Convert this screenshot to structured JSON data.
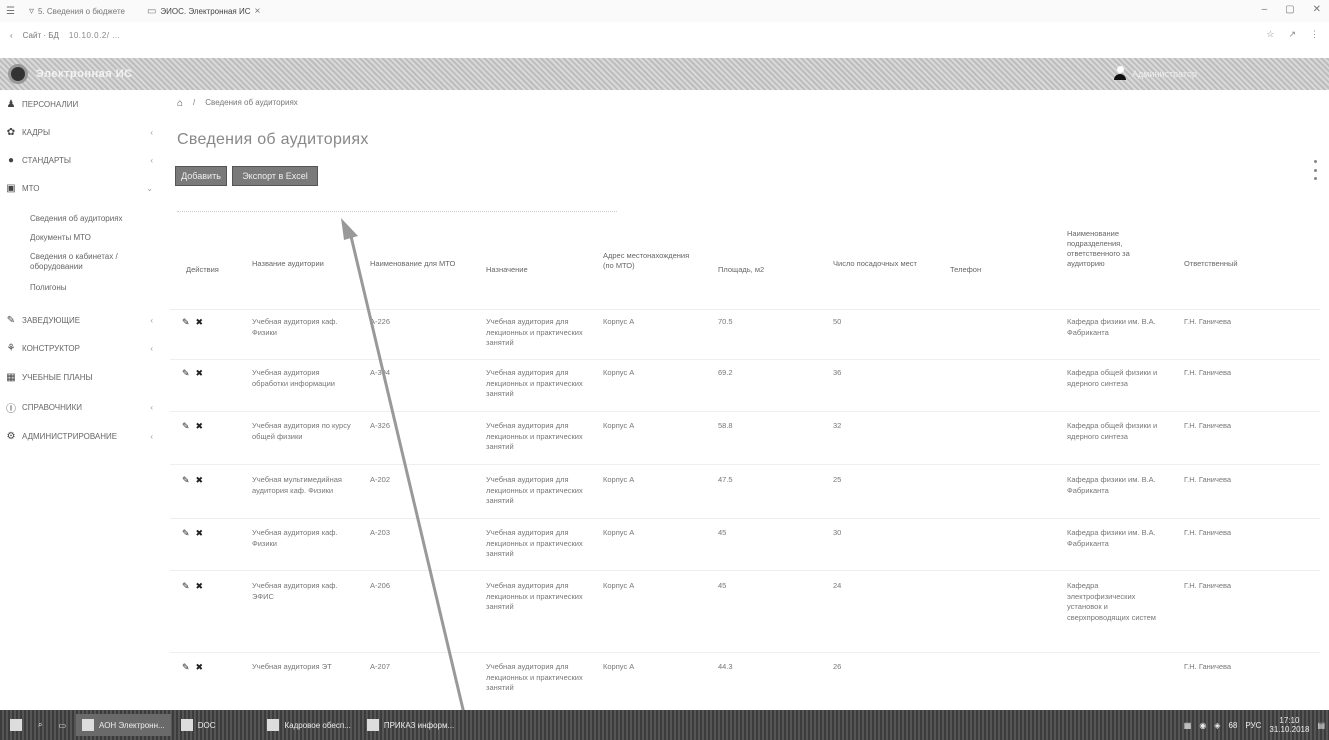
{
  "browser": {
    "tabs": [
      {
        "label": "5. Сведения о бюджете"
      },
      {
        "label": "ЭИОС. Электронная ИС"
      }
    ],
    "address_left": "Сайт  ·  БД",
    "address_url": "10.10.0.2/ ...",
    "window_controls": [
      "–",
      "▢",
      "✕"
    ],
    "addr_icons": [
      "☆",
      "↗",
      "⋮"
    ]
  },
  "header": {
    "app_title": "Электронная ИС",
    "user_name": "Администратор"
  },
  "sidebar": {
    "items": [
      {
        "label": "Персоналии",
        "icon": "user-icon",
        "glyph": "♟"
      },
      {
        "label": "Кадры",
        "icon": "award-icon",
        "glyph": "✿"
      },
      {
        "label": "Стандарты",
        "icon": "circle-icon",
        "glyph": "●"
      },
      {
        "label": "МТО",
        "icon": "chart-icon",
        "glyph": "▣"
      },
      {
        "label": "Заведующие",
        "icon": "book-icon",
        "glyph": "✎"
      },
      {
        "label": "Конструктор",
        "icon": "sitemap-icon",
        "glyph": "⚘"
      },
      {
        "label": "Учебные планы",
        "icon": "table-icon",
        "glyph": "▦"
      },
      {
        "label": "Справочники",
        "icon": "info-icon",
        "glyph": "ⓘ"
      },
      {
        "label": "Администрирование",
        "icon": "cogs-icon",
        "glyph": "⚙"
      }
    ],
    "subitems": [
      "Сведения об аудиториях",
      "Документы МТО",
      "Сведения о кабинетах / оборудовании",
      "Полигоны"
    ]
  },
  "main": {
    "breadcrumb_home": "⌂",
    "breadcrumb_sep": "/",
    "breadcrumb_current": "Сведения об аудиториях",
    "title": "Сведения об аудиториях",
    "btn_add": "Добавить",
    "btn_excel": "Экспорт в Excel"
  },
  "table": {
    "headers": [
      "Действия",
      "Название аудитории",
      "Наименование для МТО",
      "Назначение",
      "Адрес местонахождения (по МТО)",
      "Площадь, м2",
      "Число посадочных мест",
      "Телефон",
      "Наименование подразделения, ответственного за аудиторию",
      "Ответственный"
    ],
    "rows": [
      {
        "name": "Учебная аудитория каф. Физики",
        "mto": "A-226",
        "purpose": "Учебная аудитория для лекционных и практических занятий",
        "address": "Корпус А",
        "area": "70.5",
        "seats": "50",
        "phone": "",
        "dept": "Кафедра физики им. В.А. Фабриканта",
        "resp": "Г.Н. Ганичева"
      },
      {
        "name": "Учебная аудитория обработки информации",
        "mto": "A-304",
        "purpose": "Учебная аудитория для лекционных и практических занятий",
        "address": "Корпус А",
        "area": "69.2",
        "seats": "36",
        "phone": "",
        "dept": "Кафедра общей физики и ядерного синтеза",
        "resp": "Г.Н. Ганичева"
      },
      {
        "name": "Учебная аудитория по курсу общей физики",
        "mto": "A-326",
        "purpose": "Учебная аудитория для лекционных и практических занятий",
        "address": "Корпус А",
        "area": "58.8",
        "seats": "32",
        "phone": "",
        "dept": "Кафедра общей физики и ядерного синтеза",
        "resp": "Г.Н. Ганичева"
      },
      {
        "name": "Учебная мультимедийная аудитория каф. Физики",
        "mto": "A-202",
        "purpose": "Учебная аудитория для лекционных и практических занятий",
        "address": "Корпус А",
        "area": "47.5",
        "seats": "25",
        "phone": "",
        "dept": "Кафедра физики им. В.А. Фабриканта",
        "resp": "Г.Н. Ганичева"
      },
      {
        "name": "Учебная аудитория каф. Физики",
        "mto": "A-203",
        "purpose": "Учебная аудитория для лекционных и практических занятий",
        "address": "Корпус А",
        "area": "45",
        "seats": "30",
        "phone": "",
        "dept": "Кафедра физики им. В.А. Фабриканта",
        "resp": "Г.Н. Ганичева"
      },
      {
        "name": "Учебная аудитория каф. ЭФИС",
        "mto": "A-206",
        "purpose": "Учебная аудитория для лекционных и практических занятий",
        "address": "Корпус А",
        "area": "45",
        "seats": "24",
        "phone": "",
        "dept": "Кафедра электрофизических установок и сверхпроводящих систем",
        "resp": "Г.Н. Ганичева"
      },
      {
        "name": "Учебная аудитория ЭТ",
        "mto": "A-207",
        "purpose": "Учебная аудитория для лекционных и практических занятий",
        "address": "Корпус А",
        "area": "44.3",
        "seats": "26",
        "phone": "",
        "dept": "",
        "resp": "Г.Н. Ганичева"
      }
    ]
  },
  "taskbar": {
    "apps": [
      {
        "label": "АОН Электронн..."
      },
      {
        "label": "DOC"
      },
      {
        "label": "Кадровое обесп..."
      },
      {
        "label": "ПРИКАЗ информ..."
      }
    ],
    "lang": "РУС",
    "volume": "68",
    "time": "17:10",
    "date": "31.10.2018"
  }
}
